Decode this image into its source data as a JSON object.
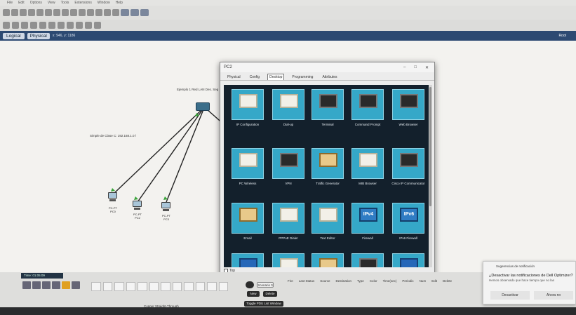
{
  "menu": [
    "File",
    "Edit",
    "Options",
    "View",
    "Tools",
    "Extensions",
    "Window",
    "Help"
  ],
  "tabs": {
    "logical": "Logical",
    "physical": "Physical",
    "breadcrumb": "x: 946, y: 1186",
    "root": "Root"
  },
  "canvas": {
    "switch_label": "Ejemplo 1 Red LAN Des. Seg",
    "network_label": "Simple de Clase C: 192.168.1.0 /",
    "pcs": [
      {
        "name": "PC-PT",
        "sub": "PC0"
      },
      {
        "name": "PC-PT",
        "sub": "PC2"
      },
      {
        "name": "PC-PT",
        "sub": "PC3"
      }
    ]
  },
  "dialog": {
    "title": "PC2",
    "tabs": [
      "Physical",
      "Config",
      "Desktop",
      "Programming",
      "Attributes"
    ],
    "apps": [
      {
        "label": "IP Configuration",
        "icon": "ip-config-icon"
      },
      {
        "label": "Dial-up",
        "icon": "dialup-icon"
      },
      {
        "label": "Terminal",
        "icon": "terminal-icon"
      },
      {
        "label": "Command Prompt",
        "icon": "command-prompt-icon"
      },
      {
        "label": "Web Browser",
        "icon": "web-browser-icon"
      },
      {
        "label": "PC Wireless",
        "icon": "wireless-icon"
      },
      {
        "label": "VPN",
        "icon": "vpn-icon"
      },
      {
        "label": "Traffic Generator",
        "icon": "traffic-generator-icon"
      },
      {
        "label": "MIB Browser",
        "icon": "mib-browser-icon"
      },
      {
        "label": "Cisco IP Communicator",
        "icon": "ip-communicator-icon"
      },
      {
        "label": "Email",
        "icon": "email-icon"
      },
      {
        "label": "PPPoE Dialer",
        "icon": "pppoe-icon"
      },
      {
        "label": "Text Editor",
        "icon": "text-editor-icon"
      },
      {
        "label": "Firewall",
        "icon": "firewall-icon"
      },
      {
        "label": "IPv6 Firewall",
        "icon": "ipv6-firewall-icon"
      },
      {
        "label": "",
        "icon": "app-icon"
      },
      {
        "label": "",
        "icon": "app-icon"
      },
      {
        "label": "",
        "icon": "folder-icon"
      },
      {
        "label": "",
        "icon": "terminal-icon"
      },
      {
        "label": "",
        "icon": "bluetooth-icon"
      }
    ],
    "top_checkbox": "Top",
    "fw_labels": {
      "ipv4": "IPv4",
      "ipv6": "IPv6"
    }
  },
  "bottom": {
    "time": "Time: 01:05:09",
    "cable_label": "Copper Straight-Through",
    "scenario": "Scenario 0",
    "new": "New",
    "delete": "Delete",
    "toggle": "Toggle PDU List Window",
    "event_headers": [
      "Fire",
      "Last Status",
      "Source",
      "Destination",
      "Type",
      "Color",
      "Time(sec)",
      "Periodic",
      "Num",
      "Edit",
      "Delete"
    ]
  },
  "notification": {
    "header": "Sugerencias de notificación",
    "title": "¿Desactivar las notificaciones de Dell Optimizer?",
    "body": "Hemos observado que hace tiempo que no las",
    "disable": "Desactivar",
    "no": "Ahora no"
  }
}
